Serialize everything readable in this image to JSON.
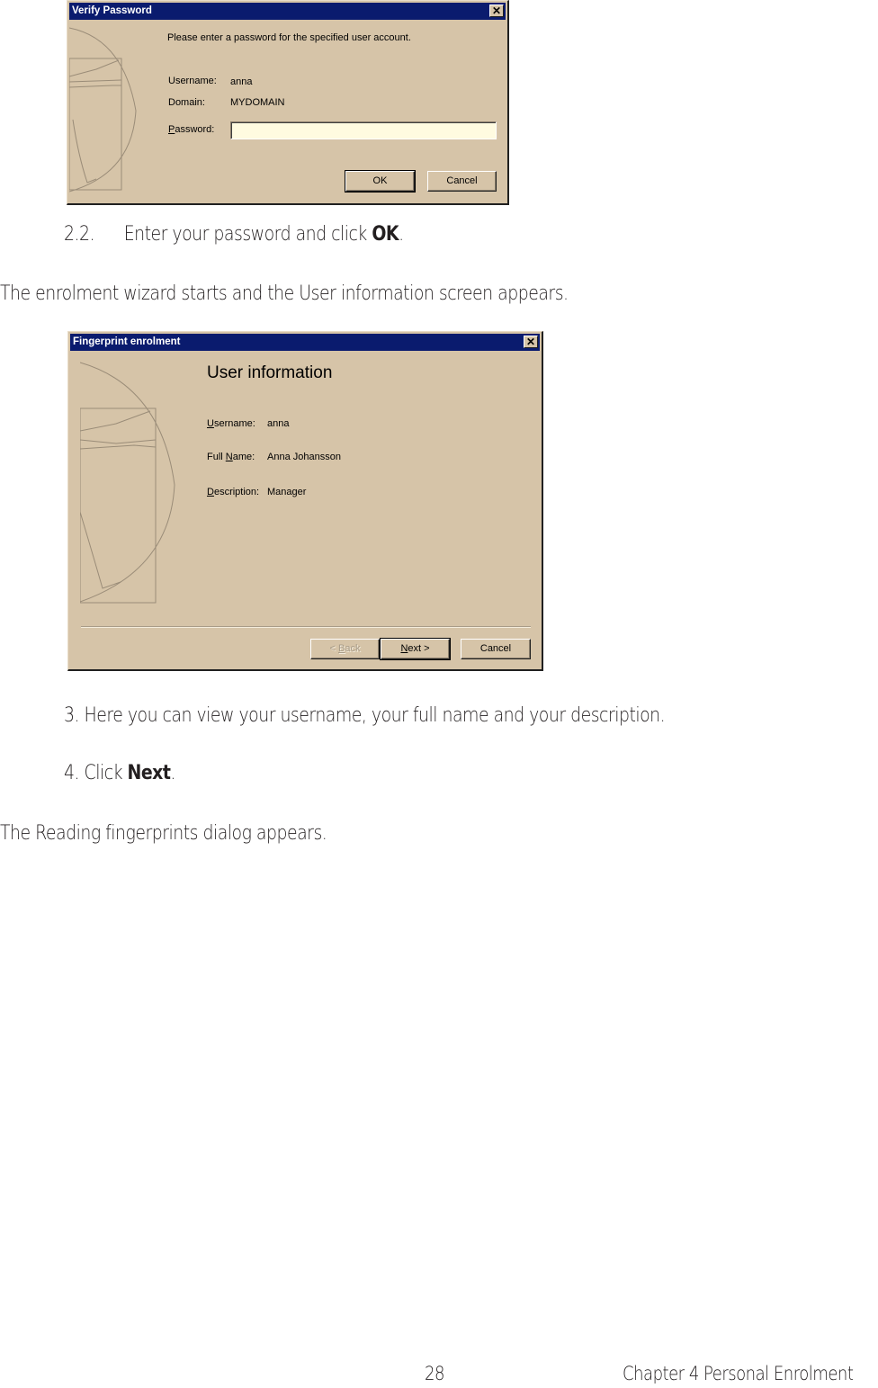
{
  "verify_dialog": {
    "title": "Verify Password",
    "close_icon": "close-icon",
    "prompt": "Please enter a password for the specified user account.",
    "username_label": "Username:",
    "username_value": "anna",
    "domain_label": "Domain:",
    "domain_value": "MYDOMAIN",
    "password_label_accel": "P",
    "password_label_rest": "assword:",
    "password_value": "",
    "ok_label": "OK",
    "cancel_label": "Cancel",
    "colors": {
      "titlebar": "#0a1b6e",
      "face": "#d6c4a8",
      "field": "#fffbe0"
    }
  },
  "step_2_2": {
    "number": "2.2.",
    "text": "Enter your password and click ",
    "bold": "OK",
    "end": "."
  },
  "para_wizard_starts": "The enrolment wizard starts and the User information screen appears.",
  "enrol_dialog": {
    "title": "Fingerprint enrolment",
    "close_icon": "close-icon",
    "heading": "User information",
    "username_label_accel": "U",
    "username_label_rest": "sername:",
    "username_value": "anna",
    "fullname_label_pre": "Full ",
    "fullname_label_accel": "N",
    "fullname_label_rest": "ame:",
    "fullname_value": "Anna Johansson",
    "description_label_accel": "D",
    "description_label_rest": "escription:",
    "description_value": "Manager",
    "back_pre": "< ",
    "back_accel": "B",
    "back_rest": "ack",
    "next_accel": "N",
    "next_rest": "ext >",
    "cancel_label": "Cancel"
  },
  "step_3": "3. Here you can view your username, your full name and your description.",
  "step_4": {
    "text": "4. Click ",
    "bold": "Next",
    "end": "."
  },
  "para_reading": "The Reading fingerprints dialog appears.",
  "footer": {
    "page_number": "28",
    "chapter": "Chapter 4 Personal Enrolment"
  }
}
